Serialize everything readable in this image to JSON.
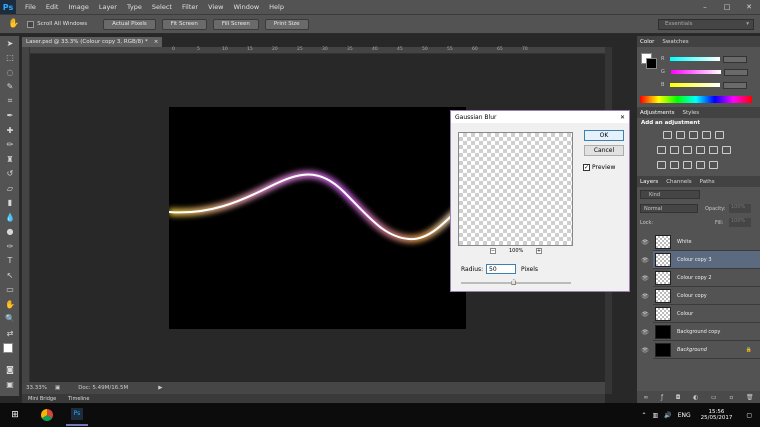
{
  "app": {
    "logo": "Ps"
  },
  "menu": [
    "File",
    "Edit",
    "Image",
    "Layer",
    "Type",
    "Select",
    "Filter",
    "View",
    "Window",
    "Help"
  ],
  "window_controls": [
    "–",
    "□",
    "✕"
  ],
  "options": {
    "scroll_all_label": "Scroll All Windows",
    "buttons": [
      "Actual Pixels",
      "Fit Screen",
      "Fill Screen",
      "Print Size"
    ],
    "workspace": "Essentials"
  },
  "document": {
    "tab_title": "Laser.psd @ 33.3% (Colour copy 3, RGB/8) *",
    "ruler_ticks": [
      "0",
      "5",
      "10",
      "15",
      "20",
      "25",
      "30",
      "35",
      "40",
      "45",
      "50",
      "55",
      "60",
      "65",
      "70"
    ],
    "zoom": "33.33%",
    "doc_size": "Doc: 5.49M/16.5M"
  },
  "bottom_tabs": [
    "Mini Bridge",
    "Timeline"
  ],
  "color_panel": {
    "tabs": [
      "Color",
      "Swatches"
    ],
    "channels": [
      {
        "label": "R",
        "value": "255"
      },
      {
        "label": "G",
        "value": "255"
      },
      {
        "label": "B",
        "value": "255"
      }
    ]
  },
  "adjustments": {
    "tabs": [
      "Adjustments",
      "Styles"
    ],
    "title": "Add an adjustment"
  },
  "layers_panel": {
    "tabs": [
      "Layers",
      "Channels",
      "Paths"
    ],
    "filter_label": "Kind",
    "blend_mode": "Normal",
    "opacity_label": "Opacity:",
    "opacity_value": "100%",
    "lock_label": "Lock:",
    "fill_label": "Fill:",
    "fill_value": "100%",
    "layers": [
      {
        "name": "White",
        "thumb": "check",
        "selected": false
      },
      {
        "name": "Colour copy 3",
        "thumb": "check",
        "selected": true
      },
      {
        "name": "Colour copy 2",
        "thumb": "check",
        "selected": false
      },
      {
        "name": "Colour copy",
        "thumb": "check",
        "selected": false
      },
      {
        "name": "Colour",
        "thumb": "check",
        "selected": false
      },
      {
        "name": "Background copy",
        "thumb": "black",
        "selected": false
      },
      {
        "name": "Background",
        "thumb": "black",
        "selected": false
      }
    ]
  },
  "dialog": {
    "title": "Gaussian Blur",
    "ok_label": "OK",
    "cancel_label": "Cancel",
    "preview_label": "Preview",
    "preview_checked": true,
    "zoom_level": "100%",
    "radius_label": "Radius:",
    "radius_value": "50",
    "radius_unit": "Pixels",
    "radius_slider_fraction": 0.48
  },
  "taskbar": {
    "language": "ENG",
    "time": "15:56",
    "date": "25/05/2017"
  }
}
